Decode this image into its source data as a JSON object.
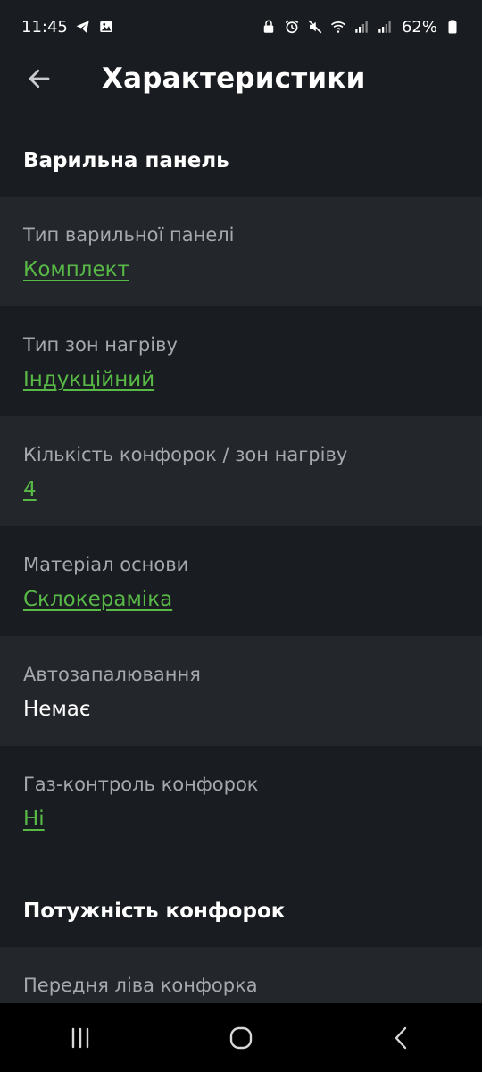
{
  "status_bar": {
    "time": "11:45",
    "battery": "62%"
  },
  "header": {
    "title": "Характеристики"
  },
  "sections": [
    {
      "title": "Варильна панель",
      "items": [
        {
          "label": "Тип варильної панелі",
          "value": "Комплект"
        },
        {
          "label": "Тип зон нагріву",
          "value": "Індукційний"
        },
        {
          "label": "Кількість конфорок / зон нагріву",
          "value": "4"
        },
        {
          "label": "Матеріал основи",
          "value": "Склокераміка"
        },
        {
          "label": "Автозапалювання",
          "value": "Немає"
        },
        {
          "label": "Газ-контроль конфорок",
          "value": "Ні"
        }
      ]
    },
    {
      "title": "Потужність конфорок",
      "items": [
        {
          "label": "Передня ліва конфорка"
        }
      ]
    }
  ],
  "colors": {
    "background": "#191c20",
    "row_alt": "#23272b",
    "link": "#58b947",
    "label": "#a5a8ac"
  },
  "icons": {
    "back": "arrow-left-icon",
    "recents": "recents-icon",
    "home": "home-icon",
    "nav_back": "chevron-left-icon"
  }
}
